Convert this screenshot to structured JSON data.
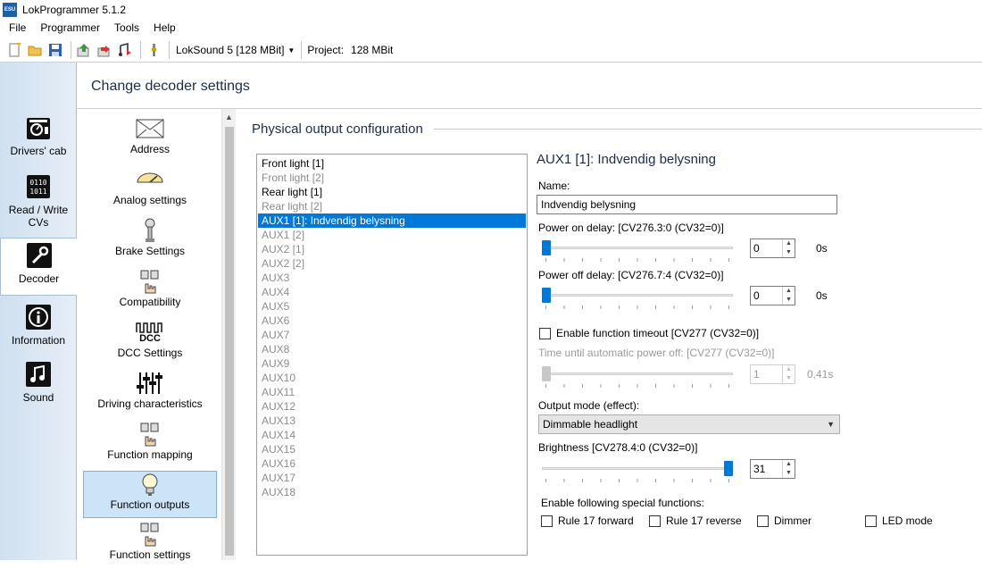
{
  "window": {
    "title": "LokProgrammer 5.1.2",
    "icon_text": "ESU"
  },
  "menu": [
    "File",
    "Programmer",
    "Tools",
    "Help"
  ],
  "toolbar": {
    "icons": [
      "new-file-icon",
      "open-folder-icon",
      "save-icon",
      "read-decoder-icon",
      "write-decoder-icon",
      "write-sound-icon",
      "tool-icon"
    ],
    "decoder_type": "LokSound 5 [128 MBit]",
    "project_label": "Project:",
    "project_value": "128 MBit"
  },
  "nav": {
    "items": [
      {
        "label": "Drivers' cab",
        "icon": "drivers-cab-icon"
      },
      {
        "label": "Read / Write CVs",
        "icon": "read-write-cvs-icon"
      },
      {
        "label": "Decoder",
        "icon": "wrench-icon",
        "active": true
      },
      {
        "label": "Information",
        "icon": "info-icon"
      },
      {
        "label": "Sound",
        "icon": "music-note-icon"
      }
    ]
  },
  "header": {
    "title": "Change decoder settings"
  },
  "settings": {
    "items": [
      {
        "label": "Address",
        "icon": "envelope-icon"
      },
      {
        "label": "Analog settings",
        "icon": "gauge-icon"
      },
      {
        "label": "Brake Settings",
        "icon": "brake-lever-icon"
      },
      {
        "label": "Compatibility",
        "icon": "hand-switches-icon"
      },
      {
        "label": "DCC Settings",
        "icon": "dcc-icon",
        "icon_text": "DCC"
      },
      {
        "label": "Driving characteristics",
        "icon": "sliders-icon"
      },
      {
        "label": "Function mapping",
        "icon": "hand-switches-icon"
      },
      {
        "label": "Function outputs",
        "icon": "light-bulb-icon",
        "active": true
      },
      {
        "label": "Function settings",
        "icon": "hand-switches-icon"
      }
    ]
  },
  "section": {
    "title": "Physical output configuration"
  },
  "outputs": [
    {
      "label": "Front light [1]",
      "state": "enabled"
    },
    {
      "label": "Front light [2]",
      "state": "disabled"
    },
    {
      "label": "Rear light [1]",
      "state": "enabled"
    },
    {
      "label": "Rear light [2]",
      "state": "disabled"
    },
    {
      "label": "AUX1 [1]: Indvendig belysning",
      "state": "selected"
    },
    {
      "label": "AUX1 [2]",
      "state": "disabled"
    },
    {
      "label": "AUX2 [1]",
      "state": "disabled"
    },
    {
      "label": "AUX2 [2]",
      "state": "disabled"
    },
    {
      "label": "AUX3",
      "state": "disabled"
    },
    {
      "label": "AUX4",
      "state": "disabled"
    },
    {
      "label": "AUX5",
      "state": "disabled"
    },
    {
      "label": "AUX6",
      "state": "disabled"
    },
    {
      "label": "AUX7",
      "state": "disabled"
    },
    {
      "label": "AUX8",
      "state": "disabled"
    },
    {
      "label": "AUX9",
      "state": "disabled"
    },
    {
      "label": "AUX10",
      "state": "disabled"
    },
    {
      "label": "AUX11",
      "state": "disabled"
    },
    {
      "label": "AUX12",
      "state": "disabled"
    },
    {
      "label": "AUX13",
      "state": "disabled"
    },
    {
      "label": "AUX14",
      "state": "disabled"
    },
    {
      "label": "AUX15",
      "state": "disabled"
    },
    {
      "label": "AUX16",
      "state": "disabled"
    },
    {
      "label": "AUX17",
      "state": "disabled"
    },
    {
      "label": "AUX18",
      "state": "disabled"
    }
  ],
  "detail": {
    "title": "AUX1 [1]: Indvendig belysning",
    "name_label": "Name:",
    "name_value": "Indvendig belysning",
    "power_on": {
      "label": "Power on delay: [CV276.3:0 (CV32=0)]",
      "value": "0",
      "unit": "0s",
      "level": 0
    },
    "power_off": {
      "label": "Power off delay: [CV276.7:4 (CV32=0)]",
      "value": "0",
      "unit": "0s",
      "level": 0
    },
    "timeout": {
      "label": "Enable function timeout [CV277 (CV32=0)]",
      "checked": false
    },
    "auto_off": {
      "label": "Time until automatic power off: [CV277 (CV32=0)]",
      "value": "1",
      "unit": "0,41s",
      "level": 0,
      "enabled": false
    },
    "output_mode": {
      "label": "Output mode (effect):",
      "value": "Dimmable headlight"
    },
    "brightness": {
      "label": "Brightness [CV278.4:0 (CV32=0)]",
      "value": "31",
      "level": 1.0
    },
    "special": {
      "label": "Enable following special functions:",
      "options": [
        {
          "label": "Rule 17 forward",
          "checked": false
        },
        {
          "label": "Rule 17 reverse",
          "checked": false
        },
        {
          "label": "Dimmer",
          "checked": false
        },
        {
          "label": "LED mode",
          "checked": false
        }
      ]
    }
  },
  "colors": {
    "accent": "#0078d7",
    "selection_bg": "#cce4f7",
    "heading": "#1d2c4a"
  }
}
